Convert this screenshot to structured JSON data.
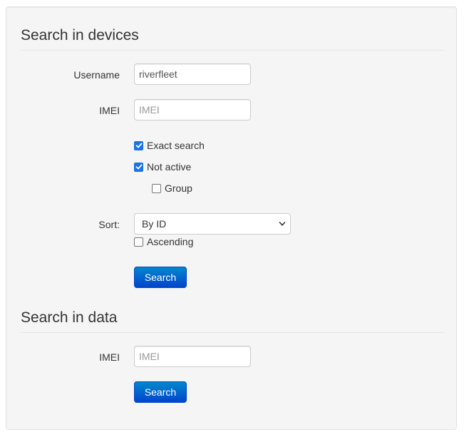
{
  "devices_section": {
    "title": "Search in devices",
    "username": {
      "label": "Username",
      "value": "riverfleet",
      "placeholder": ""
    },
    "imei": {
      "label": "IMEI",
      "value": "",
      "placeholder": "IMEI"
    },
    "exact_search": {
      "label": "Exact search",
      "checked": true
    },
    "not_active": {
      "label": "Not active",
      "checked": true
    },
    "group": {
      "label": "Group",
      "checked": false
    },
    "sort": {
      "label": "Sort:",
      "selected": "By ID"
    },
    "ascending": {
      "label": "Ascending",
      "checked": false
    },
    "search_button": "Search"
  },
  "data_section": {
    "title": "Search in data",
    "imei": {
      "label": "IMEI",
      "value": "",
      "placeholder": "IMEI"
    },
    "search_button": "Search"
  },
  "colors": {
    "accent": "#1a73e8",
    "button_top": "#0088cc",
    "button_bottom": "#0044cc",
    "panel_bg": "#f5f5f5"
  }
}
